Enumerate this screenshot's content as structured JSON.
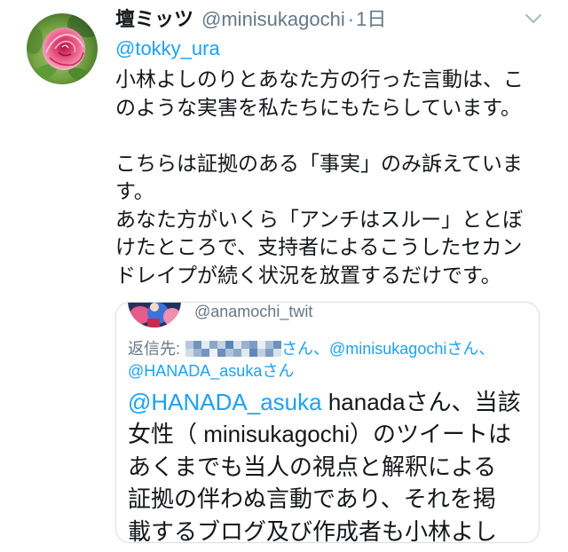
{
  "colors": {
    "accent": "#1DA1F2",
    "text": "#14171A",
    "secondary": "#657786",
    "border": "#D6DEE5",
    "icon": "#AAB8C2"
  },
  "icons": {
    "menu": "chevron-down-icon",
    "author_avatar": "rose-avatar",
    "redaction": "mosaic-blur"
  },
  "tweet": {
    "author": {
      "display_name": "壇ミッツ",
      "handle": "@minisukagochi",
      "separator": "·",
      "time": "1日"
    },
    "reply_to": "@tokky_ura",
    "body": {
      "paragraphs": [
        [
          "小林よしのりとあなた方の行った言動は、こ",
          "のような実害を私たちにもたらしています。"
        ],
        [
          "こちらは証拠のある「事実」のみ訴えていま",
          "す。",
          "あなた方がいくら「アンチはスルー」ととぼ",
          "けたところで、支持者によるこうしたセカン",
          "ドレイプが続く状況を放置するだけです。"
        ]
      ]
    },
    "attached_image": {
      "handle": "@anamochi_twit",
      "reply_to": {
        "label": "返信先:",
        "line1_rest": "さん、@minisukagochiさん、",
        "line2": "@HANADA_asukaさん"
      },
      "text": {
        "mention": "@HANADA_asuka",
        "line1_rest": " hanadaさん、当該",
        "lines": [
          "女性（ minisukagochi）のツイートは",
          "あくまでも当人の視点と解釈による",
          "証拠の伴わぬ言動であり、それを掲",
          "載するブログ及び作成者も小林よし"
        ]
      }
    }
  }
}
